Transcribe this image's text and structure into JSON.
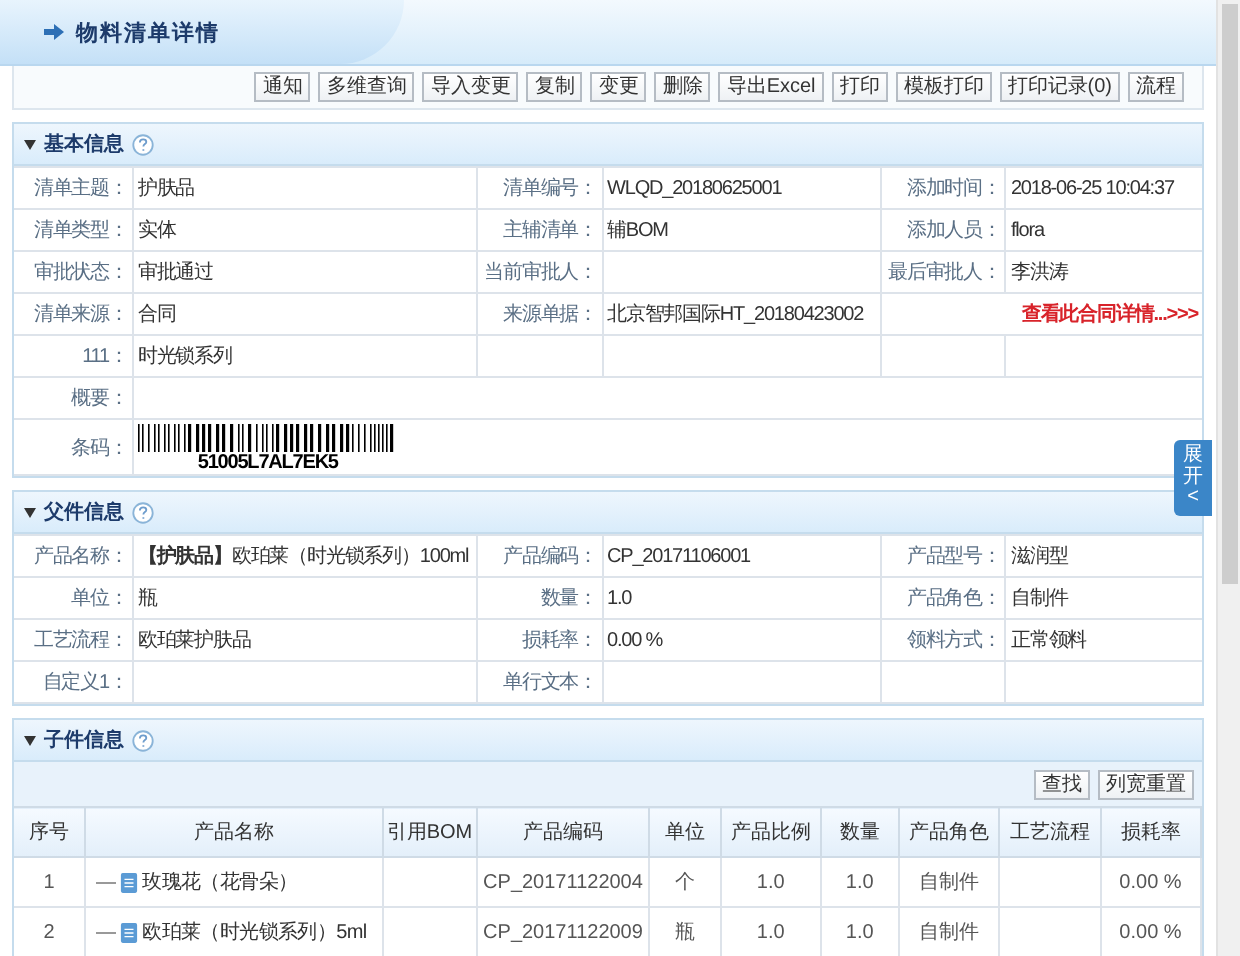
{
  "page_title": "物料清单详情",
  "toolbar_buttons": [
    "通知",
    "多维查询",
    "导入变更",
    "复制",
    "变更",
    "删除",
    "导出Excel",
    "打印",
    "模板打印",
    "打印记录(0)",
    "流程"
  ],
  "basic_info": {
    "title": "基本信息",
    "rows": [
      {
        "kind": "pairs",
        "pairs": [
          {
            "label": "清单主题：",
            "value": "护肤品"
          },
          {
            "label": "清单编号：",
            "value": "WLQD_20180625001"
          },
          {
            "label": "添加时间：",
            "value": "2018-06-25 10:04:37"
          }
        ]
      },
      {
        "kind": "pairs",
        "pairs": [
          {
            "label": "清单类型：",
            "value": "实体"
          },
          {
            "label": "主辅清单：",
            "value": "辅BOM"
          },
          {
            "label": "添加人员：",
            "value": "flora"
          }
        ]
      },
      {
        "kind": "pairs",
        "pairs": [
          {
            "label": "审批状态：",
            "value": "审批通过"
          },
          {
            "label": "当前审批人："
          },
          {
            "label": "最后审批人：",
            "value": "李洪涛"
          }
        ]
      },
      {
        "kind": "pairs",
        "pairs": [
          {
            "label": "清单来源：",
            "value": "合同"
          },
          {
            "label": "来源单据：",
            "value": "北京智邦国际HT_20180423002"
          }
        ],
        "link": "查看此合同详情...>>>"
      },
      {
        "kind": "pairs",
        "pairs": [
          {
            "label": "111：",
            "value": "时光锁系列"
          }
        ]
      },
      {
        "kind": "wide",
        "label": "概要："
      },
      {
        "kind": "barcode",
        "label": "条码：",
        "value": "51005L7AL7EK5"
      }
    ]
  },
  "side_button": {
    "label": "展开",
    "arrow": "<"
  },
  "parent_info": {
    "title": "父件信息",
    "rows": [
      {
        "kind": "pairs",
        "pairs": [
          {
            "label": "产品名称：",
            "value": "**【护肤品】**欧珀莱（时光锁系列）100ml"
          },
          {
            "label": "产品编码：",
            "value": "CP_20171106001"
          },
          {
            "label": "产品型号：",
            "value": "滋润型"
          }
        ]
      },
      {
        "kind": "pairs",
        "pairs": [
          {
            "label": "单位：",
            "value": "瓶"
          },
          {
            "label": "数量：",
            "value": "1.0"
          },
          {
            "label": "产品角色：",
            "value": "自制件"
          }
        ]
      },
      {
        "kind": "pairs",
        "pairs": [
          {
            "label": "工艺流程：",
            "value": "欧珀莱护肤品"
          },
          {
            "label": "损耗率：",
            "value": "0.00 %"
          },
          {
            "label": "领料方式：",
            "value": "正常领料"
          }
        ]
      },
      {
        "kind": "pairs",
        "pairs": [
          {
            "label": "自定义1："
          },
          {
            "label": "单行文本："
          }
        ]
      }
    ]
  },
  "child_info": {
    "title": "子件信息",
    "buttons": [
      "查找",
      "列宽重置"
    ],
    "columns": [
      "序号",
      "产品名称",
      "引用BOM",
      "产品编码",
      "单位",
      "产品比例",
      "数量",
      "产品角色",
      "工艺流程",
      "损耗率"
    ],
    "rows": [
      {
        "index": "1",
        "name": "玫瑰花（花骨朵）",
        "code": "CP_20171122004",
        "unit": "个",
        "ratio": "1.0",
        "qty": "1.0",
        "role": "自制件",
        "loss": "0.00 %"
      },
      {
        "index": "2",
        "name": "欧珀莱（时光锁系列）5ml",
        "code": "CP_20171122009",
        "unit": "瓶",
        "ratio": "1.0",
        "qty": "1.0",
        "role": "自制件",
        "loss": "0.00 %"
      }
    ]
  }
}
